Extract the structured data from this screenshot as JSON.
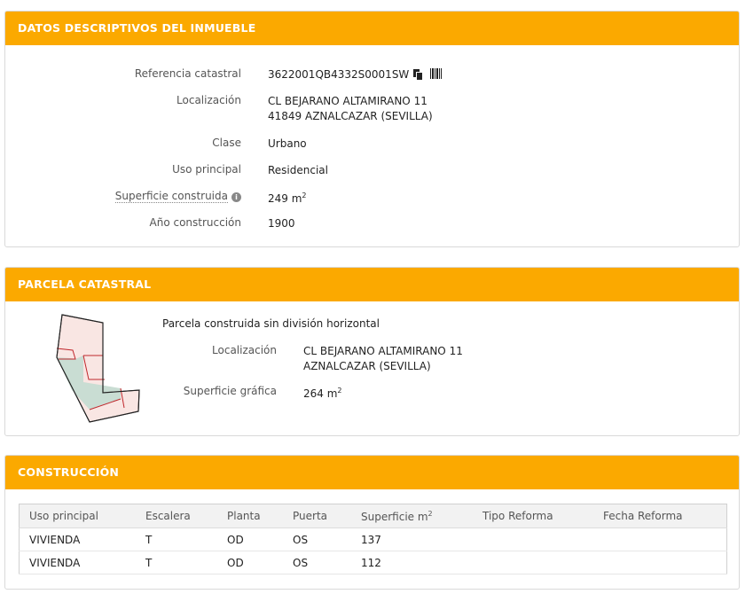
{
  "datos": {
    "title": "DATOS DESCRIPTIVOS DEL INMUEBLE",
    "referencia_label": "Referencia catastral",
    "referencia_value": "3622001QB4332S0001SW",
    "localizacion_label": "Localización",
    "localizacion_line1": "CL BEJARANO ALTAMIRANO 11",
    "localizacion_line2": "41849 AZNALCAZAR (SEVILLA)",
    "clase_label": "Clase",
    "clase_value": "Urbano",
    "uso_label": "Uso principal",
    "uso_value": "Residencial",
    "superficie_label": "Superficie construida",
    "superficie_value": "249 m",
    "superficie_exp": "2",
    "anio_label": "Año construcción",
    "anio_value": "1900",
    "icons": [
      "copy-icon",
      "barcode-icon",
      "info-icon"
    ]
  },
  "parcela": {
    "title": "PARCELA CATASTRAL",
    "description": "Parcela construida sin división horizontal",
    "localizacion_label": "Localización",
    "localizacion_line1": "CL BEJARANO ALTAMIRANO 11",
    "localizacion_line2": "AZNALCAZAR (SEVILLA)",
    "superficie_label": "Superficie gráfica",
    "superficie_value": "264 m",
    "superficie_exp": "2"
  },
  "construccion": {
    "title": "CONSTRUCCIÓN",
    "headers": [
      "Uso principal",
      "Escalera",
      "Planta",
      "Puerta",
      "Superficie m",
      "Tipo Reforma",
      "Fecha Reforma"
    ],
    "superficie_header_exp": "2",
    "rows": [
      [
        "VIVIENDA",
        "T",
        "OD",
        "OS",
        "137",
        "",
        ""
      ],
      [
        "VIVIENDA",
        "T",
        "OD",
        "OS",
        "112",
        "",
        ""
      ]
    ]
  },
  "colors": {
    "header_bg": "#fba900",
    "plot_fill_main": "#c9ddd3",
    "plot_fill_other": "#f9e6e3",
    "plot_line": "#c0282d"
  }
}
